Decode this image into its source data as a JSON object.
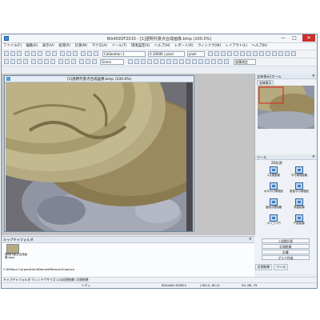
{
  "window": {
    "title": "WinROOF2015 - [1]透明代景点合成画像.bmp (100.0%)",
    "controls": [
      "—",
      "□",
      "✕"
    ]
  },
  "menu": [
    "ファイル(F)",
    "編集(E)",
    "表示(V)",
    "処理(P)",
    "計測(M)",
    "マクロ(A)",
    "ツール(T)",
    "環境設定(S)",
    "ヘルプ(H)",
    "レポート(R)",
    "ウィンドウ(W)",
    "レイアウト(L)",
    "ヘルプ(H)"
  ],
  "toolbar": {
    "calibration": "Calibration 1",
    "scale": "0.10000 / pixel",
    "unit": "pixel",
    "color_mode": "Green",
    "area_button": "面積測定"
  },
  "image_window": {
    "title": "[1]透明代景点合成画像.bmp (100.0%)"
  },
  "right_panel": {
    "overview_title": "全体表示/ズーム",
    "overview_tab": "全体表示",
    "tools_title": "ツール",
    "tools_subtitle": "2D計測",
    "tools": [
      {
        "label": "2点間距離"
      },
      {
        "label": "平行線間距離"
      },
      {
        "label": "水平平行線間距離"
      },
      {
        "label": "垂直平行線間距離"
      },
      {
        "label": "連続点間距離"
      },
      {
        "label": "角度距離"
      },
      {
        "label": "ポリゴン円"
      },
      {
        "label": "円弧距離"
      }
    ],
    "side_buttons": [
      "2点間計測",
      "計測結果",
      "計算",
      "グラフ作成"
    ],
    "bottom_tabs": [
      "計測結果",
      "ツール"
    ]
  },
  "capture": {
    "title": "キャプチャフォルダ",
    "thumb_label": "透明代景点合成画像.bmp",
    "path": "C:¥Mitani Corporation¥Demo¥MeasureCapture"
  },
  "status": {
    "left": "キャプチャフォルダ ウィンドウサイズ (2D計測結果) 計測結果",
    "mode": "レディ",
    "size": "800x600 RGB24",
    "pos": "(780.0, 85.0)",
    "rgb": "94, 88, 79"
  },
  "colors": {
    "accent": "#3b8bd9",
    "coin_gold": "#b5aa80",
    "coin_silver": "#8f95a3"
  }
}
